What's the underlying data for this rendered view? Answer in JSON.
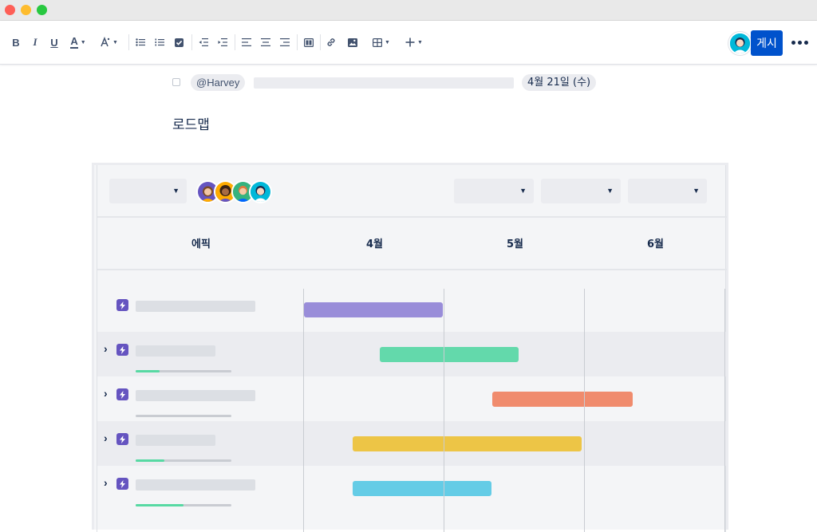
{
  "colors": {
    "publish": "#0052cc",
    "epic_icon": "#6554c0",
    "progress_fill": "#57d9a3"
  },
  "toolbar": {
    "items": [
      {
        "name": "bold-icon",
        "glyph": "B"
      },
      {
        "name": "italic-icon",
        "glyph": "I"
      },
      {
        "name": "underline-icon",
        "glyph": "U"
      },
      {
        "name": "text-color-icon",
        "glyph": "A"
      },
      {
        "name": "text-style-icon"
      },
      {
        "name": "bullet-list-icon"
      },
      {
        "name": "numbered-list-icon"
      },
      {
        "name": "task-list-icon"
      },
      {
        "name": "outdent-icon"
      },
      {
        "name": "indent-icon"
      },
      {
        "name": "align-left-icon"
      },
      {
        "name": "align-center-icon"
      },
      {
        "name": "align-right-icon"
      },
      {
        "name": "layouts-icon"
      },
      {
        "name": "link-icon"
      },
      {
        "name": "image-icon"
      },
      {
        "name": "table-icon"
      },
      {
        "name": "insert-plus-icon"
      }
    ],
    "publish_label": "게시"
  },
  "task": {
    "mention": "@Harvey",
    "date": "4월 21일 (수)"
  },
  "heading": "로드맵",
  "roadmap": {
    "columns": {
      "epic": "에픽",
      "months": [
        "4월",
        "5월",
        "6월"
      ]
    },
    "rows": [
      {
        "expandable": false,
        "bar_color": "#998dd9",
        "progress": null
      },
      {
        "expandable": true,
        "bar_color": "#63d9ab",
        "progress": 0.25
      },
      {
        "expandable": true,
        "bar_color": "#f08b6d",
        "progress": 0
      },
      {
        "expandable": true,
        "bar_color": "#edc546",
        "progress": 0.3
      },
      {
        "expandable": true,
        "bar_color": "#64cce6",
        "progress": 0.5
      }
    ]
  }
}
